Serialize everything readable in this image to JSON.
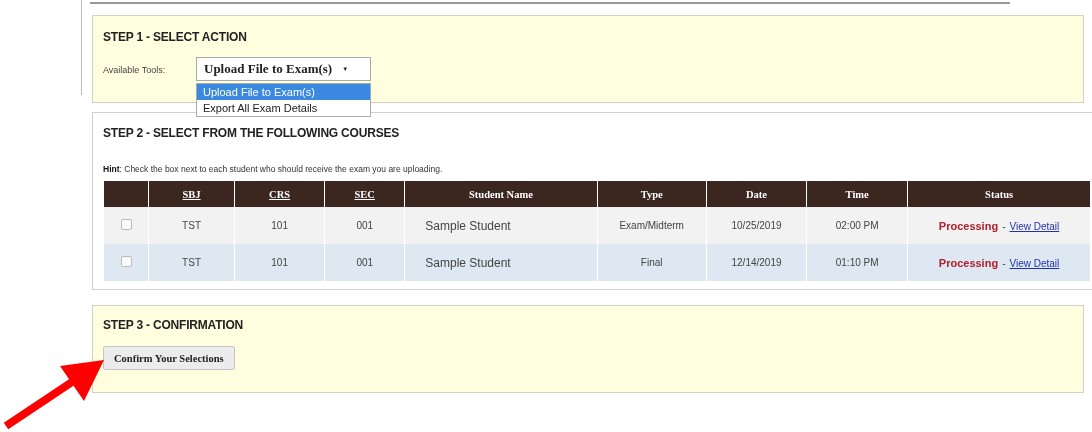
{
  "step1": {
    "title": "STEP 1 - SELECT ACTION",
    "tools_label": "Available Tools:",
    "select": {
      "value": "Upload File to Exam(s)",
      "caret": "▼",
      "expanded": true,
      "options": [
        {
          "label": "Upload File to Exam(s)",
          "selected": true
        },
        {
          "label": "Export All Exam Details",
          "selected": false
        }
      ]
    }
  },
  "step2": {
    "title": "STEP 2 - SELECT FROM THE FOLLOWING COURSES",
    "hint": "**Hint**: Check the box next to each student who should receive the exam you are uploading.",
    "table": {
      "columns": [
        {
          "label": "SBJ",
          "sortable": true
        },
        {
          "label": "CRS",
          "sortable": true
        },
        {
          "label": "SEC",
          "sortable": true
        },
        {
          "label": "Student Name",
          "sortable": false
        },
        {
          "label": "Type",
          "sortable": false
        },
        {
          "label": "Date",
          "sortable": false
        },
        {
          "label": "Time",
          "sortable": false
        },
        {
          "label": "Status",
          "sortable": false
        }
      ],
      "rows": [
        {
          "checked": false,
          "cells": [
            "TST",
            "101",
            "001",
            "Sample Student",
            "Exam/Midterm",
            "10/25/2019",
            "02:00 PM"
          ],
          "status": "Processing",
          "separator": "-",
          "link": "View Detail"
        },
        {
          "checked": false,
          "cells": [
            "TST",
            "101",
            "001",
            "Sample Student",
            "Final",
            "12/14/2019",
            "01:10 PM"
          ],
          "status": "Processing",
          "separator": "-",
          "link": "View Detail"
        }
      ]
    }
  },
  "step3": {
    "title": "STEP 3 - CONFIRMATION",
    "button": "Confirm Your Selections"
  }
}
